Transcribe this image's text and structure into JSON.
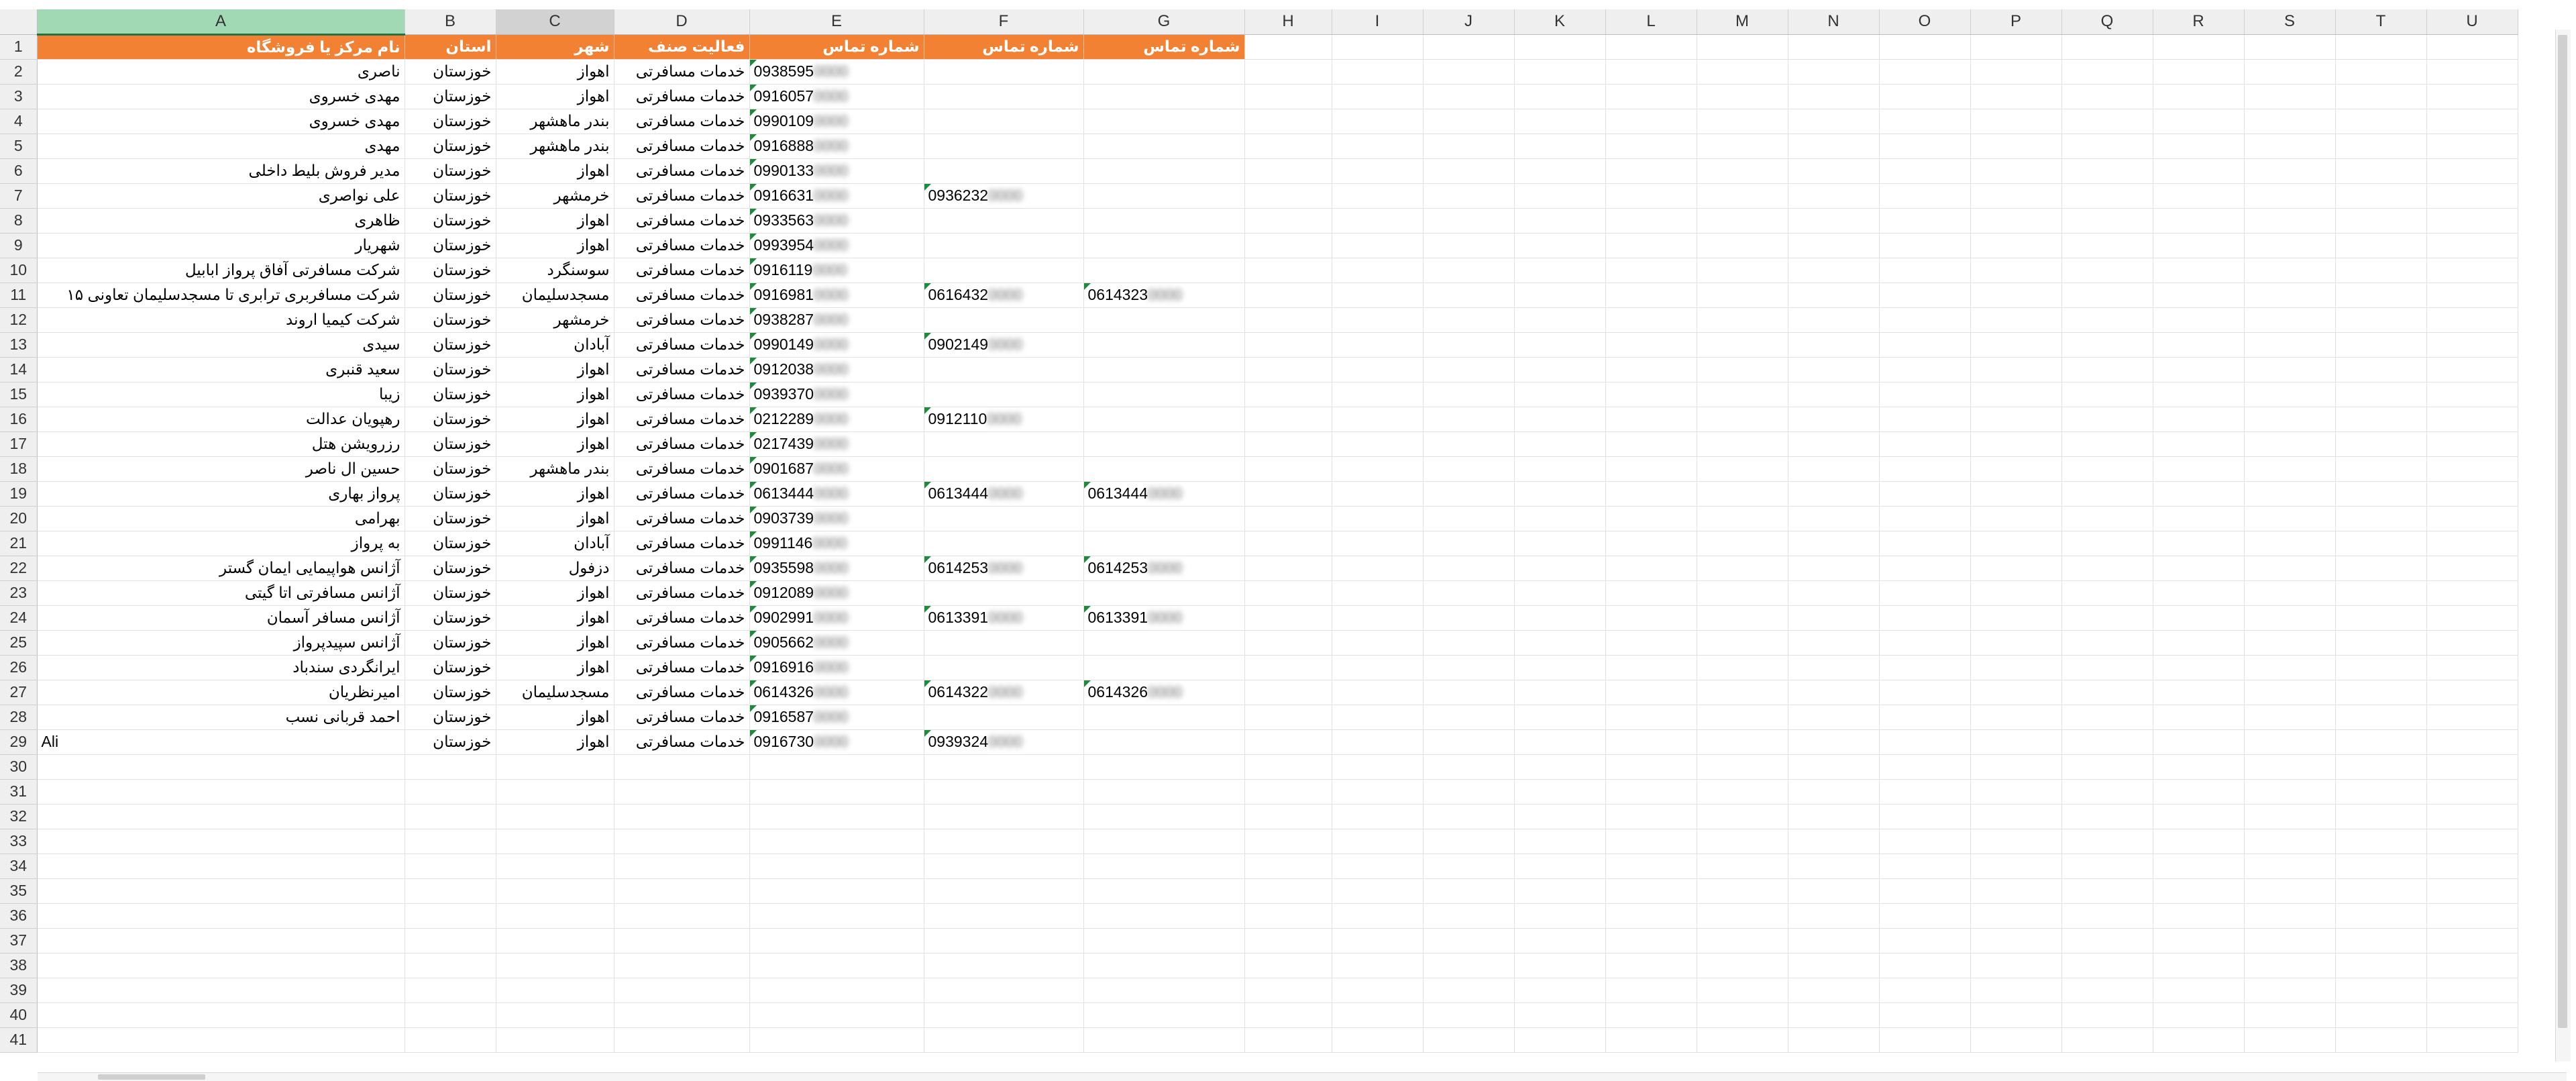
{
  "columns": [
    "A",
    "B",
    "C",
    "D",
    "E",
    "F",
    "G",
    "H",
    "I",
    "J",
    "K",
    "L",
    "M",
    "N",
    "O",
    "P",
    "Q",
    "R",
    "S",
    "T",
    "U"
  ],
  "header_row": [
    "نام مرکز یا فروشگاه",
    "استان",
    "شهر",
    "فعالیت صنف",
    "شماره تماس",
    "شماره تماس",
    "شماره تماس"
  ],
  "rows": [
    [
      "ناصری",
      "خوزستان",
      "اهواز",
      "خدمات مسافرتی",
      "0938595",
      "",
      ""
    ],
    [
      "مهدی خسروی",
      "خوزستان",
      "اهواز",
      "خدمات مسافرتی",
      "0916057",
      "",
      ""
    ],
    [
      "مهدی خسروی",
      "خوزستان",
      "بندر ماهشهر",
      "خدمات مسافرتی",
      "0990109",
      "",
      ""
    ],
    [
      "مهدی",
      "خوزستان",
      "بندر ماهشهر",
      "خدمات مسافرتی",
      "0916888",
      "",
      ""
    ],
    [
      "مدیر فروش بلیط داخلی",
      "خوزستان",
      "اهواز",
      "خدمات مسافرتی",
      "0990133",
      "",
      ""
    ],
    [
      "علی نواصری",
      "خوزستان",
      "خرمشهر",
      "خدمات مسافرتی",
      "0916631",
      "0936232",
      ""
    ],
    [
      "ظاهری",
      "خوزستان",
      "اهواز",
      "خدمات مسافرتی",
      "0933563",
      "",
      ""
    ],
    [
      "شهریار",
      "خوزستان",
      "اهواز",
      "خدمات مسافرتی",
      "0993954",
      "",
      ""
    ],
    [
      "شرکت مسافرتی آفاق پرواز ابابیل",
      "خوزستان",
      "سوسنگرد",
      "خدمات مسافرتی",
      "0916119",
      "",
      ""
    ],
    [
      "شرکت مسافربری ترابری تا مسجدسلیمان تعاونی ۱۵",
      "خوزستان",
      "مسجدسلیمان",
      "خدمات مسافرتی",
      "0916981",
      "0616432",
      "0614323"
    ],
    [
      "شرکت کیمیا اروند",
      "خوزستان",
      "خرمشهر",
      "خدمات مسافرتی",
      "0938287",
      "",
      ""
    ],
    [
      "سیدی",
      "خوزستان",
      "آبادان",
      "خدمات مسافرتی",
      "0990149",
      "0902149",
      ""
    ],
    [
      "سعید قنبری",
      "خوزستان",
      "اهواز",
      "خدمات مسافرتی",
      "0912038",
      "",
      ""
    ],
    [
      "زیبا",
      "خوزستان",
      "اهواز",
      "خدمات مسافرتی",
      "0939370",
      "",
      ""
    ],
    [
      "رهپویان عدالت",
      "خوزستان",
      "اهواز",
      "خدمات مسافرتی",
      "0212289",
      "0912110",
      ""
    ],
    [
      "رزرویشن هتل",
      "خوزستان",
      "اهواز",
      "خدمات مسافرتی",
      "0217439",
      "",
      ""
    ],
    [
      "حسین ال ناصر",
      "خوزستان",
      "بندر ماهشهر",
      "خدمات مسافرتی",
      "0901687",
      "",
      ""
    ],
    [
      "پرواز بهاری",
      "خوزستان",
      "اهواز",
      "خدمات مسافرتی",
      "0613444",
      "0613444",
      "0613444"
    ],
    [
      "بهرامی",
      "خوزستان",
      "اهواز",
      "خدمات مسافرتی",
      "0903739",
      "",
      ""
    ],
    [
      "به پرواز",
      "خوزستان",
      "آبادان",
      "خدمات مسافرتی",
      "0991146",
      "",
      ""
    ],
    [
      "آژانس هواپیمایی ایمان گستر",
      "خوزستان",
      "دزفول",
      "خدمات مسافرتی",
      "0935598",
      "0614253",
      "0614253"
    ],
    [
      "آژانس مسافرتی اتا گیتی",
      "خوزستان",
      "اهواز",
      "خدمات مسافرتی",
      "0912089",
      "",
      ""
    ],
    [
      "آژانس مسافر آسمان",
      "خوزستان",
      "اهواز",
      "خدمات مسافرتی",
      "0902991",
      "0613391",
      "0613391"
    ],
    [
      "آژانس سپیدپرواز",
      "خوزستان",
      "اهواز",
      "خدمات مسافرتی",
      "0905662",
      "",
      ""
    ],
    [
      "ایرانگردی سندباد",
      "خوزستان",
      "اهواز",
      "خدمات مسافرتی",
      "0916916",
      "",
      ""
    ],
    [
      "امیرنظریان",
      "خوزستان",
      "مسجدسلیمان",
      "خدمات مسافرتی",
      "0614326",
      "0614322",
      "0614326"
    ],
    [
      "احمد قربانی نسب",
      "خوزستان",
      "اهواز",
      "خدمات مسافرتی",
      "0916587",
      "",
      ""
    ],
    [
      "Ali",
      "خوزستان",
      "اهواز",
      "خدمات مسافرتی",
      "0916730",
      "0939324",
      ""
    ]
  ],
  "total_rows": 41,
  "blurred_suffix": "0000",
  "colors": {
    "header_fill": "#f28133",
    "header_text": "#ffffff",
    "gridline": "#e1e1e1",
    "note_marker": "#1e8a3c"
  }
}
